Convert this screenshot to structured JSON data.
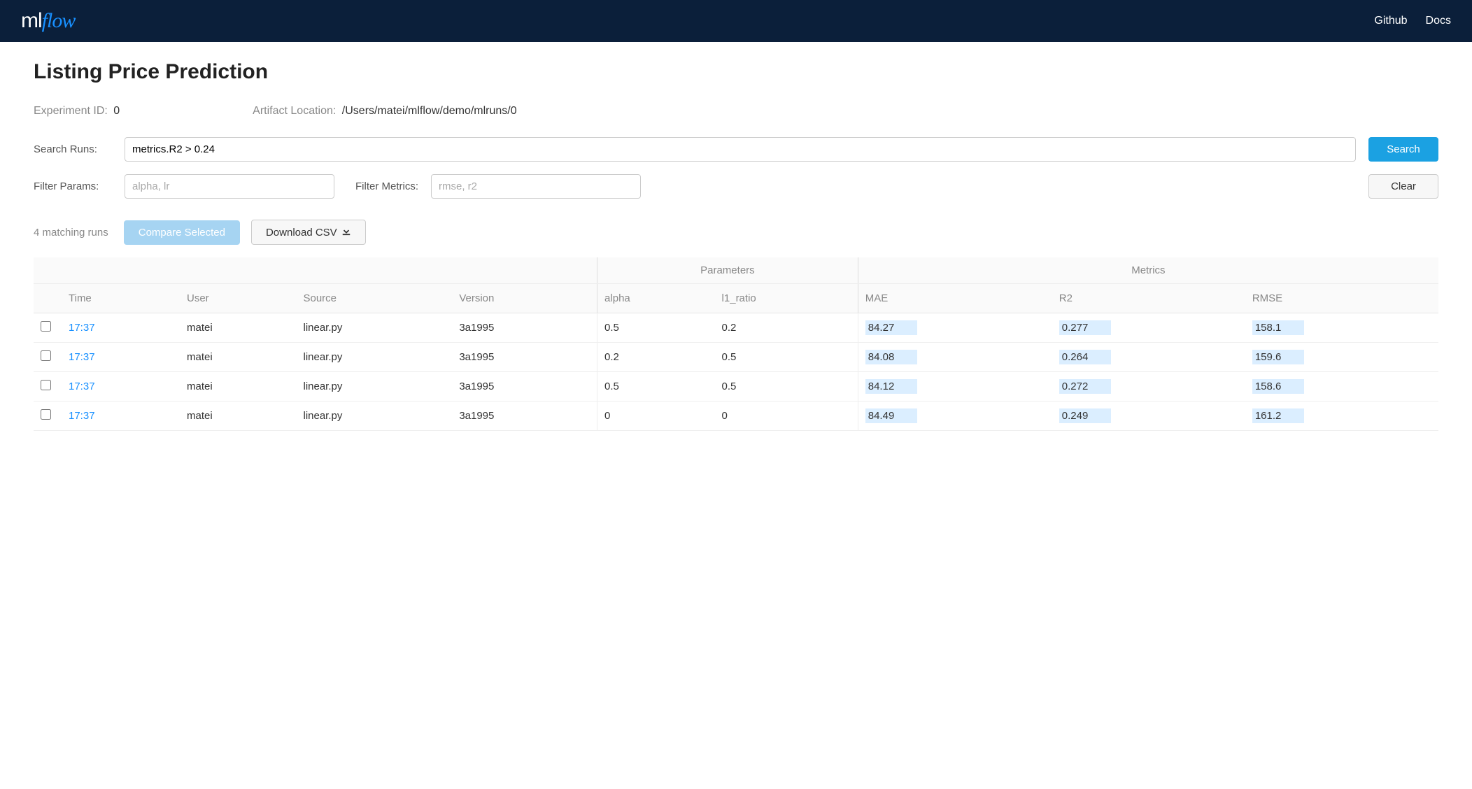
{
  "nav": {
    "logo_ml": "ml",
    "logo_flow": "flow",
    "github": "Github",
    "docs": "Docs"
  },
  "page": {
    "title": "Listing Price Prediction",
    "experiment_id_label": "Experiment ID:",
    "experiment_id_value": "0",
    "artifact_label": "Artifact Location:",
    "artifact_value": "/Users/matei/mlflow/demo/mlruns/0"
  },
  "search": {
    "label": "Search Runs:",
    "value": "metrics.R2 > 0.24",
    "button": "Search"
  },
  "filters": {
    "params_label": "Filter Params:",
    "params_placeholder": "alpha, lr",
    "metrics_label": "Filter Metrics:",
    "metrics_placeholder": "rmse, r2",
    "clear": "Clear"
  },
  "actions": {
    "matching": "4 matching runs",
    "compare": "Compare Selected",
    "download": "Download CSV"
  },
  "table": {
    "group_params": "Parameters",
    "group_metrics": "Metrics",
    "cols": {
      "time": "Time",
      "user": "User",
      "source": "Source",
      "version": "Version",
      "alpha": "alpha",
      "l1_ratio": "l1_ratio",
      "mae": "MAE",
      "r2": "R2",
      "rmse": "RMSE"
    },
    "rows": [
      {
        "time": "17:37",
        "user": "matei",
        "source": "linear.py",
        "version": "3a1995",
        "alpha": "0.5",
        "l1_ratio": "0.2",
        "mae": "84.27",
        "r2": "0.277",
        "rmse": "158.1"
      },
      {
        "time": "17:37",
        "user": "matei",
        "source": "linear.py",
        "version": "3a1995",
        "alpha": "0.2",
        "l1_ratio": "0.5",
        "mae": "84.08",
        "r2": "0.264",
        "rmse": "159.6"
      },
      {
        "time": "17:37",
        "user": "matei",
        "source": "linear.py",
        "version": "3a1995",
        "alpha": "0.5",
        "l1_ratio": "0.5",
        "mae": "84.12",
        "r2": "0.272",
        "rmse": "158.6"
      },
      {
        "time": "17:37",
        "user": "matei",
        "source": "linear.py",
        "version": "3a1995",
        "alpha": "0",
        "l1_ratio": "0",
        "mae": "84.49",
        "r2": "0.249",
        "rmse": "161.2"
      }
    ]
  }
}
